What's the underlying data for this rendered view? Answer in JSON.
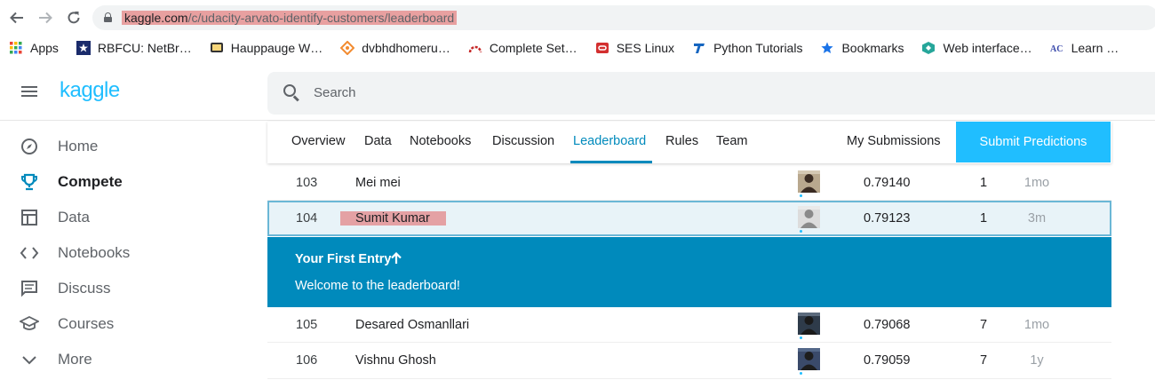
{
  "browser": {
    "url_domain": "kaggle.com",
    "url_path": "/c/udacity-arvato-identify-customers/leaderboard",
    "bookmarks": [
      {
        "label": "Apps",
        "icon": "apps-grid-icon",
        "color": "#4285f4"
      },
      {
        "label": "RBFCU: NetBr…",
        "icon": "star-badge-icon",
        "color": "#1a2b6b"
      },
      {
        "label": "Hauppauge W…",
        "icon": "tv-icon",
        "color": "#333333"
      },
      {
        "label": "dvbhdhomeru…",
        "icon": "diamond-icon",
        "color": "#f28b30"
      },
      {
        "label": "Complete Set…",
        "icon": "arc-icon",
        "color": "#c62828"
      },
      {
        "label": "SES Linux",
        "icon": "oracle-icon",
        "color": "#d32f2f"
      },
      {
        "label": "Python Tutorials",
        "icon": "t-logo-icon",
        "color": "#1565c0"
      },
      {
        "label": "Bookmarks",
        "icon": "star-icon",
        "color": "#1a73e8"
      },
      {
        "label": "Web interface…",
        "icon": "cube-icon",
        "color": "#26a69a"
      },
      {
        "label": "Learn …",
        "icon": "ac-icon",
        "color": "#3949ab"
      }
    ]
  },
  "header": {
    "logo": "kaggle",
    "search_placeholder": "Search"
  },
  "sidebar": {
    "items": [
      {
        "label": "Home",
        "icon": "compass-icon"
      },
      {
        "label": "Compete",
        "icon": "trophy-icon",
        "active": true
      },
      {
        "label": "Data",
        "icon": "table-icon"
      },
      {
        "label": "Notebooks",
        "icon": "code-icon"
      },
      {
        "label": "Discuss",
        "icon": "comment-icon"
      },
      {
        "label": "Courses",
        "icon": "school-icon"
      },
      {
        "label": "More",
        "icon": "chevron-down-icon"
      }
    ]
  },
  "tabs": {
    "items": [
      "Overview",
      "Data",
      "Notebooks",
      "Discussion",
      "Leaderboard",
      "Rules",
      "Team"
    ],
    "active": "Leaderboard",
    "my_submissions": "My Submissions",
    "submit": "Submit Predictions"
  },
  "leaderboard": {
    "rows": [
      {
        "rank": "103",
        "name": "Mei mei",
        "score": "0.79140",
        "entries": "1",
        "last": "1mo"
      },
      {
        "rank": "104",
        "name": "Sumit Kumar",
        "score": "0.79123",
        "entries": "1",
        "last": "3m",
        "highlight": true
      },
      {
        "rank": "105",
        "name": "Desared Osmanllari",
        "score": "0.79068",
        "entries": "7",
        "last": "1mo"
      },
      {
        "rank": "106",
        "name": "Vishnu Ghosh",
        "score": "0.79059",
        "entries": "7",
        "last": "1y"
      }
    ],
    "banner_title": "Your First Entry",
    "banner_text": "Welcome to the leaderboard!"
  },
  "colors": {
    "accent": "#20beff",
    "tab_active": "#008abc",
    "banner": "#008abc",
    "highlight_row": "#e8f3f8"
  }
}
